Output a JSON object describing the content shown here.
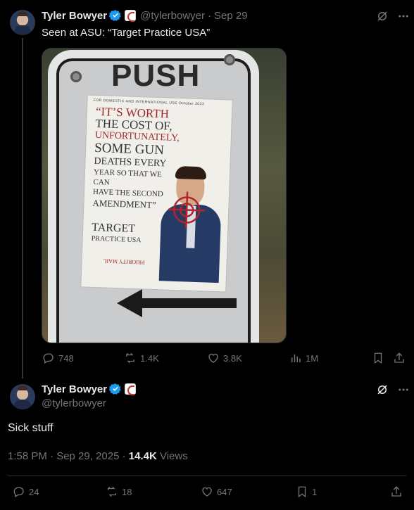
{
  "tweet": {
    "author_name": "Tyler Bowyer",
    "handle": "@tylerbowyer",
    "date": "Sep 29",
    "text": "Seen at ASU: “Target Practice USA”",
    "photo": {
      "sign_text": "PUSH",
      "poster_top": "FOR DOMESTIC AND INTERNATIONAL USE   October 2023",
      "poster_quote_1": "“It’s worth",
      "poster_quote_2": "the cost of,",
      "poster_quote_3": "unfortunately,",
      "poster_quote_4": "some gun",
      "poster_quote_5": "deaths every",
      "poster_quote_6": "year so that we can",
      "poster_quote_7": "have the second",
      "poster_quote_8": "amendment”",
      "poster_target_1": "TARGET",
      "poster_target_2": "PRACTICE USA",
      "poster_stamp": "PRIORITY MAIL"
    },
    "actions": {
      "replies": "748",
      "reposts": "1.4K",
      "likes": "3.8K",
      "views": "1M"
    }
  },
  "reply": {
    "author_name": "Tyler Bowyer",
    "handle": "@tylerbowyer",
    "text": "Sick stuff",
    "time": "1:58 PM · Sep 29, 2025 · ",
    "views_count": "14.4K",
    "views_label": " Views",
    "actions": {
      "replies": "24",
      "reposts": "18",
      "likes": "647",
      "bookmarks": "1"
    }
  },
  "colors": {
    "verified": "#1d9bf0",
    "muted": "#71767b",
    "text": "#e7e9ea"
  }
}
